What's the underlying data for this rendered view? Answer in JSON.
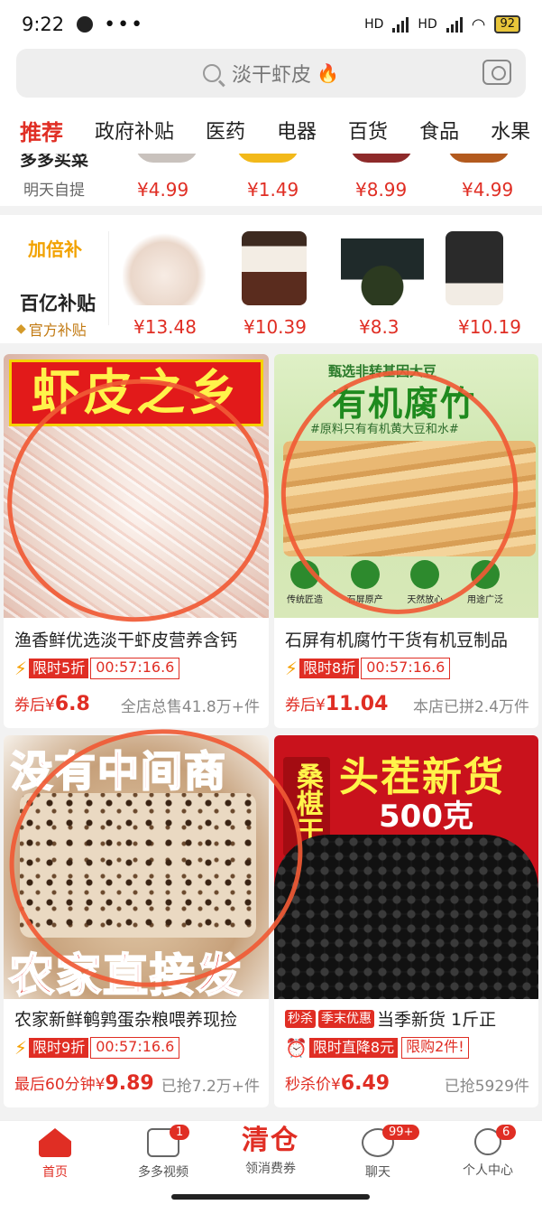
{
  "status": {
    "time": "9:22",
    "more": "•••",
    "battery": "92",
    "hd1": "HD",
    "hd2": "HD"
  },
  "search": {
    "query": "淡干虾皮"
  },
  "tabs": [
    "推荐",
    "政府补贴",
    "医药",
    "电器",
    "百货",
    "食品",
    "水果"
  ],
  "strip1": {
    "label": "多多买菜",
    "sublabel": "明天自提",
    "prices": [
      "¥4.99",
      "¥1.49",
      "¥8.99",
      "¥4.99"
    ]
  },
  "strip2": {
    "badge": "加倍补",
    "title": "百亿补贴",
    "sub": "官方补贴",
    "prices": [
      "¥13.48",
      "¥10.39",
      "¥8.3",
      "¥10.19"
    ]
  },
  "cards": [
    {
      "banner": "虾皮之乡",
      "name": "渔香鲜优选淡干虾皮营养含钙",
      "flash": "限时5折",
      "timer": "00:57:16.6",
      "price_prefix": "券后¥",
      "price": "6.8",
      "sold": "全店总售41.8万+件"
    },
    {
      "banner": "有机腐竹",
      "banner_top": "甄选非转基因大豆",
      "banner_sub": "#原料只有有机黄大豆和水#",
      "icons": [
        "传统匠造",
        "石屏原产",
        "天然放心",
        "用途广泛"
      ],
      "name": "石屏有机腐竹干货有机豆制品",
      "flash": "限时8折",
      "timer": "00:57:16.6",
      "price_prefix": "券后¥",
      "price": "11.04",
      "sold": "本店已拼2.4万件"
    },
    {
      "banner": "没有中间商",
      "banner_bottom": "农家直接发",
      "name": "农家新鲜鹌鹑蛋杂粮喂养现捡",
      "flash": "限时9折",
      "timer": "00:57:16.6",
      "price_prefix": "最后60分钟¥",
      "price": "9.89",
      "sold": "已抢7.2万+件"
    },
    {
      "banner": "头茬新货",
      "banner_weight": "500克",
      "banner_side": "桑椹干",
      "badge1": "秒杀",
      "badge2": "季末优惠",
      "name": "当季新货 1斤正",
      "flash": "限时直降8元",
      "limit": "限购2件!",
      "price_prefix": "秒杀价¥",
      "price": "6.49",
      "sold": "已抢5929件"
    }
  ],
  "nav": {
    "home": "首页",
    "video": "多多视频",
    "video_badge": "1",
    "clear_big": "清仓",
    "clear": "领消费券",
    "chat": "聊天",
    "chat_badge": "99+",
    "me": "个人中心",
    "me_badge": "6"
  },
  "colors": {
    "accent": "#e02e24",
    "circle": "#f05a35"
  }
}
